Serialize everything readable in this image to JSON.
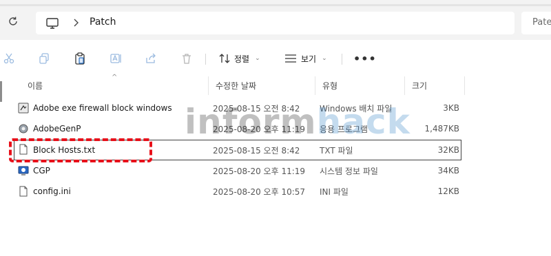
{
  "address": {
    "crumb": "Patch"
  },
  "search": {
    "placeholder": "Pate"
  },
  "toolbar": {
    "sort_label": "정렬",
    "view_label": "보기",
    "more_label": "•••"
  },
  "columns": {
    "name": "이름",
    "modified": "수정한 날짜",
    "type": "유형",
    "size": "크기"
  },
  "files": [
    {
      "name": "Adobe exe firewall block windows",
      "modified": "2025-08-15 오전 8:42",
      "type": "Windows 배치 파일",
      "size": "3KB",
      "icon": "batch-file-icon"
    },
    {
      "name": "AdobeGenP",
      "modified": "2025-08-20 오후 11:19",
      "type": "응용 프로그램",
      "size": "1,487KB",
      "icon": "application-icon"
    },
    {
      "name": "Block Hosts.txt",
      "modified": "2025-08-15 오전 8:42",
      "type": "TXT 파일",
      "size": "32KB",
      "icon": "text-file-icon"
    },
    {
      "name": "CGP",
      "modified": "2025-08-20 오후 11:19",
      "type": "시스템 정보 파일",
      "size": "34KB",
      "icon": "system-info-file-icon"
    },
    {
      "name": "config.ini",
      "modified": "2025-08-20 오후 10:57",
      "type": "INI 파일",
      "size": "12KB",
      "icon": "ini-file-icon"
    }
  ],
  "watermark": {
    "part1": "inform",
    "part2": "hack"
  },
  "colors": {
    "selection_border": "#404040",
    "annotation": "#e8101a",
    "watermark_accent": "#2f7fc4"
  }
}
